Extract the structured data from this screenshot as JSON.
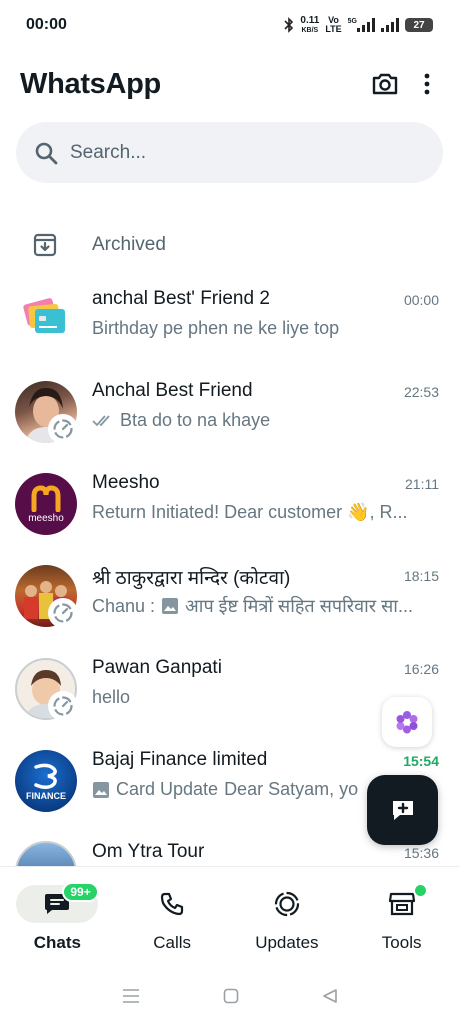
{
  "status_bar": {
    "time": "00:00",
    "net_speed_value": "0.11",
    "net_speed_unit": "KB/S",
    "volte_top": "Vo",
    "volte_bottom": "LTE",
    "network": "5G",
    "battery": "27"
  },
  "header": {
    "title": "WhatsApp",
    "camera_icon": "camera-icon",
    "menu_icon": "more-vertical-icon"
  },
  "search": {
    "placeholder": "Search..."
  },
  "archived": {
    "label": "Archived",
    "icon": "archive-icon"
  },
  "chats": [
    {
      "name": "anchal Best' Friend 2",
      "time": "00:00",
      "preview": "Birthday pe phen ne ke liye top",
      "unread": false
    },
    {
      "name": "Anchal Best Friend",
      "time": "22:53",
      "preview": "Bta do to na khaye",
      "ticks": "double-check-icon",
      "unread": false
    },
    {
      "name": "Meesho",
      "time": "21:11",
      "preview": "Return Initiated!  Dear customer 👋,  R...",
      "avatar_text": "meesho",
      "avatar_color": "#570d48",
      "unread": false
    },
    {
      "name": "श्री ठाकुरद्वारा मन्दिर (कोटवा)",
      "time": "18:15",
      "sender": "Chanu :",
      "preview": "आप ईष्ट मित्रों सहित सपरिवार सा...",
      "unread": false
    },
    {
      "name": "Pawan Ganpati",
      "time": "16:26",
      "preview": "hello",
      "unread": false
    },
    {
      "name": "Bajaj Finance limited",
      "time": "15:54",
      "preview_prefix": "Card Update",
      "preview": "Dear Satyam, yo",
      "avatar_text": "FINANCE",
      "unread": true
    },
    {
      "name": "Om Ytra Tour",
      "time": "15:36",
      "preview": "",
      "unread": false
    }
  ],
  "bottom_nav": [
    {
      "label": "Chats",
      "icon": "chats-icon",
      "badge": "99+",
      "active": true
    },
    {
      "label": "Calls",
      "icon": "phone-icon",
      "active": false
    },
    {
      "label": "Updates",
      "icon": "updates-icon",
      "active": false
    },
    {
      "label": "Tools",
      "icon": "store-icon",
      "active": false,
      "dot": true
    }
  ],
  "colors": {
    "accent_green": "#1daa61",
    "badge_green": "#25d366",
    "text_primary": "#111b21",
    "text_secondary": "#667781",
    "search_bg": "#f0f2f5",
    "fab_bg": "#111b21"
  }
}
